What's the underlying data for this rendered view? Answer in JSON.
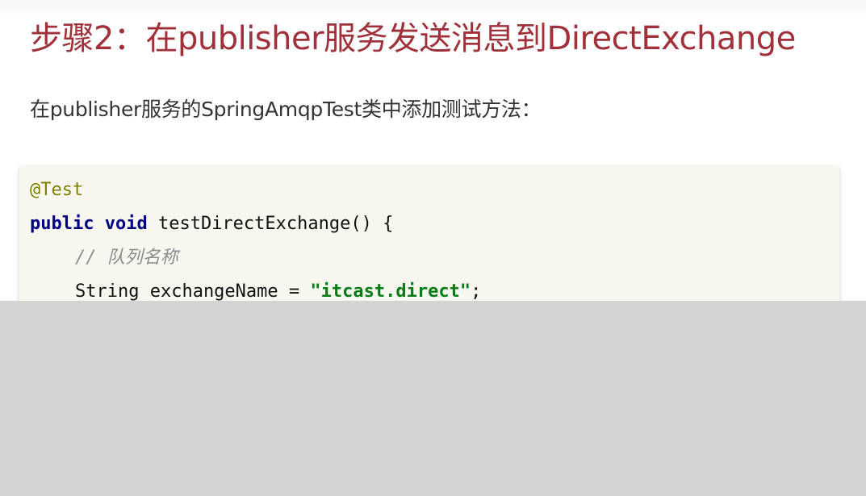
{
  "slide": {
    "title": "步骤2：在publisher服务发送消息到DirectExchange",
    "subtitle": "在publisher服务的SpringAmqpTest类中添加测试方法："
  },
  "code": {
    "annotation": "@Test",
    "kw_public": "public",
    "kw_void": "void",
    "method_signature": " testDirectExchange() {",
    "comment": "// 队列名称",
    "declaration": "String exchangeName = ",
    "string_literal": "\"itcast.direct\"",
    "semicolon": ";"
  },
  "colors": {
    "title": "#a0313a",
    "annotation": "#808000",
    "keyword": "#000080",
    "comment": "#8c8c8c",
    "string": "#067d17",
    "code_background": "#f7f7f0",
    "bottom_area": "#d3d3d3"
  }
}
